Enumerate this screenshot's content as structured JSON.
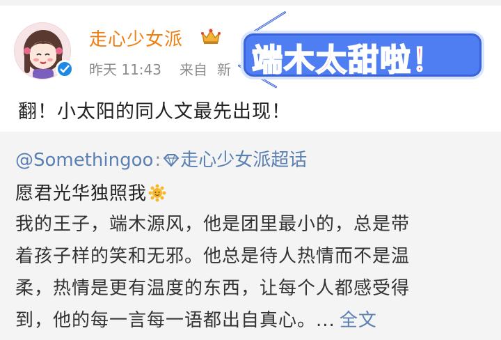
{
  "post": {
    "username": "走心少女派",
    "time": "昨天 11:43",
    "source_prefix": "来自",
    "source_trail": "新",
    "body": "翻！小太阳的同人文最先出现！"
  },
  "sticker": {
    "text": "端木太甜啦！"
  },
  "repost": {
    "mention": "@Somethingoo",
    "separator": ":",
    "topic": "走心少女派超话",
    "title": "愿君光华独照我",
    "lines": [
      "我的王子，端木源风，他是团里最小的，总是带",
      "着孩子样的笑和无邪。他总是待人热情而不是温",
      "柔，热情是更有温度的东西，让每个人都感受得",
      "到，他的每一言每一语都出自真心。"
    ],
    "ellipsis": "...",
    "fulltext_label": "全文"
  },
  "colors": {
    "username": "#f07f11",
    "link": "#5a7fb3",
    "meta": "#8c8c8c",
    "verified": "#1e88e5",
    "repost_bg": "#f4f4f4",
    "sticker_bg": "#4e7ef2",
    "sticker_text": "#ff3f7a"
  }
}
